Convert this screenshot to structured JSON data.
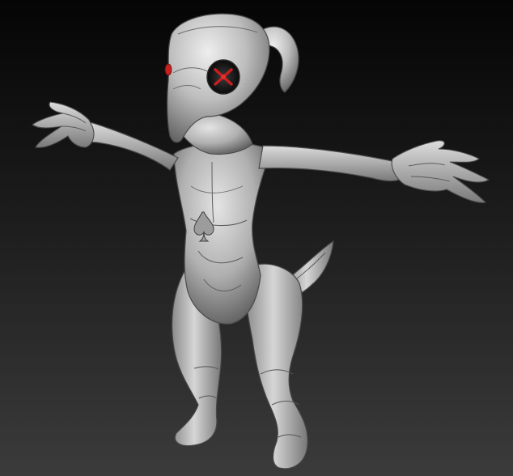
{
  "scene": {
    "subject": "sculpted-creature",
    "colors": {
      "background_top": "#050505",
      "background_bottom": "#3b3b3b",
      "clay_light": "#e2e2e2",
      "clay_mid": "#a9a9a9",
      "clay_dark": "#5c5c5c",
      "eye_accent": "#c81e1e"
    },
    "icons": [
      "spade-icon"
    ]
  }
}
